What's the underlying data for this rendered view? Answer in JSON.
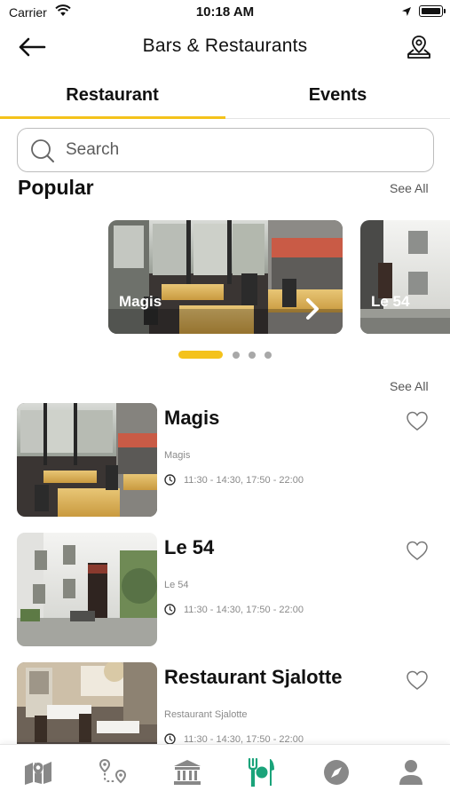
{
  "status_bar": {
    "carrier": "Carrier",
    "time": "10:18 AM"
  },
  "header": {
    "title": "Bars & Restaurants",
    "back_icon": "arrow-left-icon",
    "map_icon": "map-pin-icon"
  },
  "tabs": [
    {
      "label": "Restaurant",
      "active": true
    },
    {
      "label": "Events",
      "active": false
    }
  ],
  "search": {
    "placeholder": "Search",
    "value": ""
  },
  "popular": {
    "title": "Popular",
    "see_all": "See All",
    "cards": [
      {
        "label": "Magis"
      },
      {
        "label": "Le 54"
      }
    ],
    "pager": {
      "count": 4,
      "active_index": 0
    }
  },
  "restaurants": {
    "see_all": "See All",
    "items": [
      {
        "name": "Magis",
        "subtitle": "Magis",
        "hours": "11:30 - 14:30, 17:50 - 22:00"
      },
      {
        "name": "Le 54",
        "subtitle": "Le 54",
        "hours": "11:30 - 14:30, 17:50 - 22:00"
      },
      {
        "name": "Restaurant Sjalotte",
        "subtitle": "Restaurant Sjalotte",
        "hours": "11:30 - 14:30, 17:50 - 22:00"
      }
    ]
  },
  "tab_bar": {
    "items": [
      {
        "icon": "map-icon"
      },
      {
        "icon": "route-icon"
      },
      {
        "icon": "museum-icon"
      },
      {
        "icon": "restaurant-icon",
        "active": true
      },
      {
        "icon": "compass-icon"
      },
      {
        "icon": "profile-icon"
      }
    ]
  },
  "colors": {
    "accent": "#f4c21b",
    "active_tab_icon": "#1aa37a",
    "inactive_tab_icon": "#8a8a8a"
  }
}
